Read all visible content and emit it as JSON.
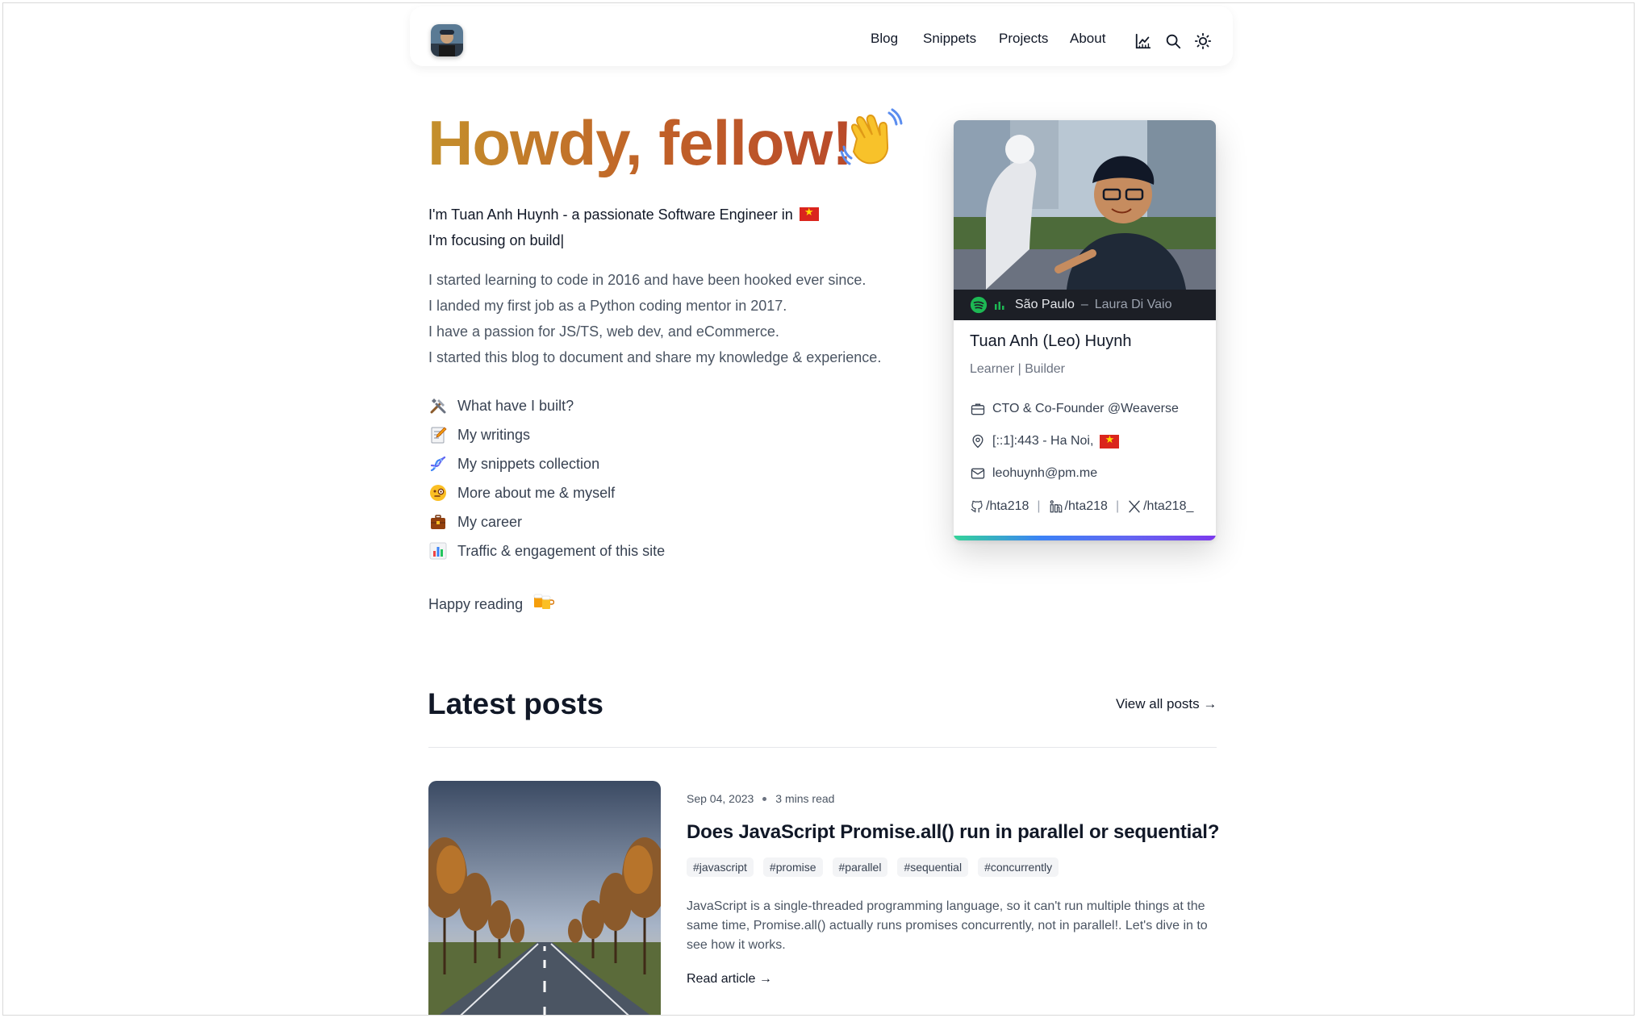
{
  "header": {
    "nav": [
      "Blog",
      "Snippets",
      "Projects",
      "About"
    ],
    "icons": [
      "analytics-icon",
      "search-icon",
      "theme-toggle-icon"
    ]
  },
  "hero": {
    "title": "Howdy, fellow!",
    "intro_line1": "I'm Tuan Anh Huynh - a passionate Software Engineer in",
    "intro_line2": "I'm focusing on build|",
    "paragraphs": [
      "I started learning to code in 2016 and have been hooked ever since.",
      "I landed my first job as a Python coding mentor in 2017.",
      "I have a passion for JS/TS, web dev, and eCommerce.",
      "I started this blog to document and share my knowledge & experience."
    ],
    "links": [
      {
        "label": "What have I built?",
        "icon": "tools-emoji"
      },
      {
        "label": "My writings",
        "icon": "memo-emoji"
      },
      {
        "label": "My snippets collection",
        "icon": "dna-emoji"
      },
      {
        "label": "More about me & myself",
        "icon": "monocle-face-emoji"
      },
      {
        "label": "My career",
        "icon": "briefcase-emoji"
      },
      {
        "label": "Traffic & engagement of this site",
        "icon": "bar-chart-emoji"
      }
    ],
    "closing": "Happy reading"
  },
  "profile": {
    "now_playing_song": "São Paulo",
    "now_playing_sep": "–",
    "now_playing_artist": "Laura Di Vaio",
    "name": "Tuan Anh (Leo) Huynh",
    "role": "Learner | Builder",
    "job": "CTO & Co-Founder @Weaverse",
    "location": "[::1]:443 - Ha Noi,",
    "email": "leohuynh@pm.me",
    "github": "/hta218",
    "linkedin": "/hta218",
    "twitter": "/hta218_",
    "colors": {
      "spotify": "#1db954",
      "bar_start": "#34d399",
      "bar_end": "#7c3aed"
    }
  },
  "latest": {
    "title": "Latest posts",
    "view_all": "View all posts →",
    "post": {
      "date": "Sep 04, 2023",
      "read_time": "3 mins read",
      "title": "Does JavaScript Promise.all() run in parallel or sequential?",
      "tags": [
        "#javascript",
        "#promise",
        "#parallel",
        "#sequential",
        "#concurrently"
      ],
      "excerpt": "JavaScript is a single-threaded programming language, so it can't run multiple things at the same time, Promise.all() actually runs promises concurrently, not in parallel!. Let's dive in to see how it works.",
      "read_more": "Read article →"
    }
  }
}
